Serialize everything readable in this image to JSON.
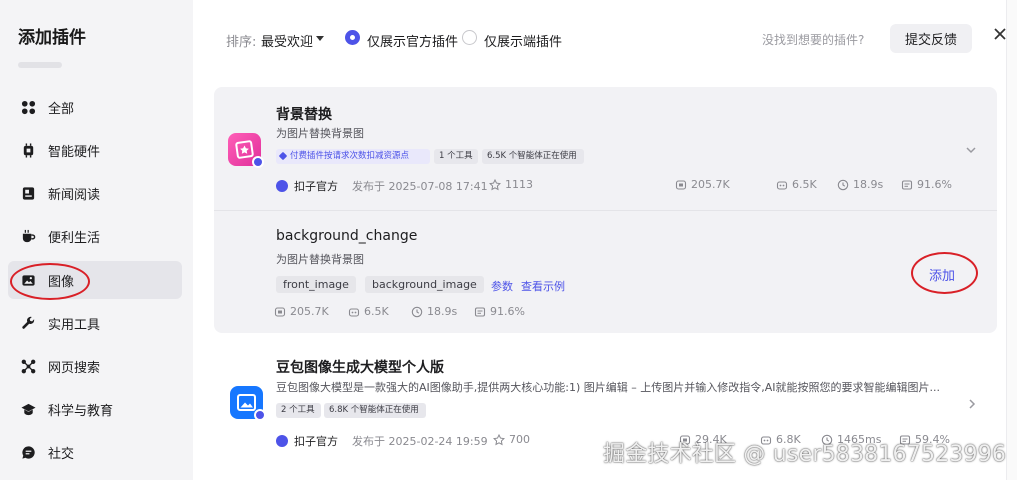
{
  "sidebar": {
    "title": "添加插件",
    "items": [
      {
        "label": "全部",
        "icon": "grid-icon"
      },
      {
        "label": "智能硬件",
        "icon": "chip-icon"
      },
      {
        "label": "新闻阅读",
        "icon": "newspaper-icon"
      },
      {
        "label": "便利生活",
        "icon": "cup-icon"
      },
      {
        "label": "图像",
        "icon": "image-icon",
        "active": true
      },
      {
        "label": "实用工具",
        "icon": "wrench-icon"
      },
      {
        "label": "网页搜索",
        "icon": "network-icon"
      },
      {
        "label": "科学与教育",
        "icon": "graduation-cap-icon"
      },
      {
        "label": "社交",
        "icon": "chat-icon"
      }
    ]
  },
  "toolbar": {
    "sort_label": "排序:",
    "sort_value": "最受欢迎",
    "filter_official": "仅展示官方插件",
    "filter_edge": "仅展示端插件",
    "not_found": "没找到想要的插件?",
    "feedback": "提交反馈"
  },
  "plugins": [
    {
      "title": "背景替换",
      "desc": "为图片替换背景图",
      "paid_tag": "付费插件按请求次数扣减资源点",
      "tools_tag": "1 个工具",
      "usage_tag": "6.5K 个智能体正在使用",
      "author": "扣子官方",
      "published": "发布于 2025-07-08 17:41",
      "stars": "1113",
      "calls": "205.7K",
      "bots": "6.5K",
      "latency": "18.9s",
      "success": "91.6%"
    },
    {
      "title": "豆包图像生成大模型个人版",
      "desc": "豆包图像大模型是一款强大的AI图像助手,提供两大核心功能:1) 图片编辑 – 上传图片并输入修改指令,AI就能按照您的要求智能编辑图片...",
      "tools_tag": "2 个工具",
      "usage_tag": "6.8K 个智能体正在使用",
      "author": "扣子官方",
      "published": "发布于 2025-02-24 19:59",
      "stars": "700",
      "calls": "29.4K",
      "bots": "6.8K",
      "latency": "1465ms",
      "success": "59.4%"
    }
  ],
  "tool": {
    "title": "background_change",
    "desc": "为图片替换背景图",
    "params": [
      "front_image",
      "background_image"
    ],
    "params_link": "参数",
    "example_link": "查看示例",
    "calls": "205.7K",
    "bots": "6.5K",
    "latency": "18.9s",
    "success": "91.6%",
    "add": "添加"
  },
  "watermark": "掘金技术社区 @ user5838167523996",
  "colors": {
    "accent": "#4d53e8",
    "annotation": "#d92027",
    "sidebar_bg": "#f4f4f6"
  }
}
